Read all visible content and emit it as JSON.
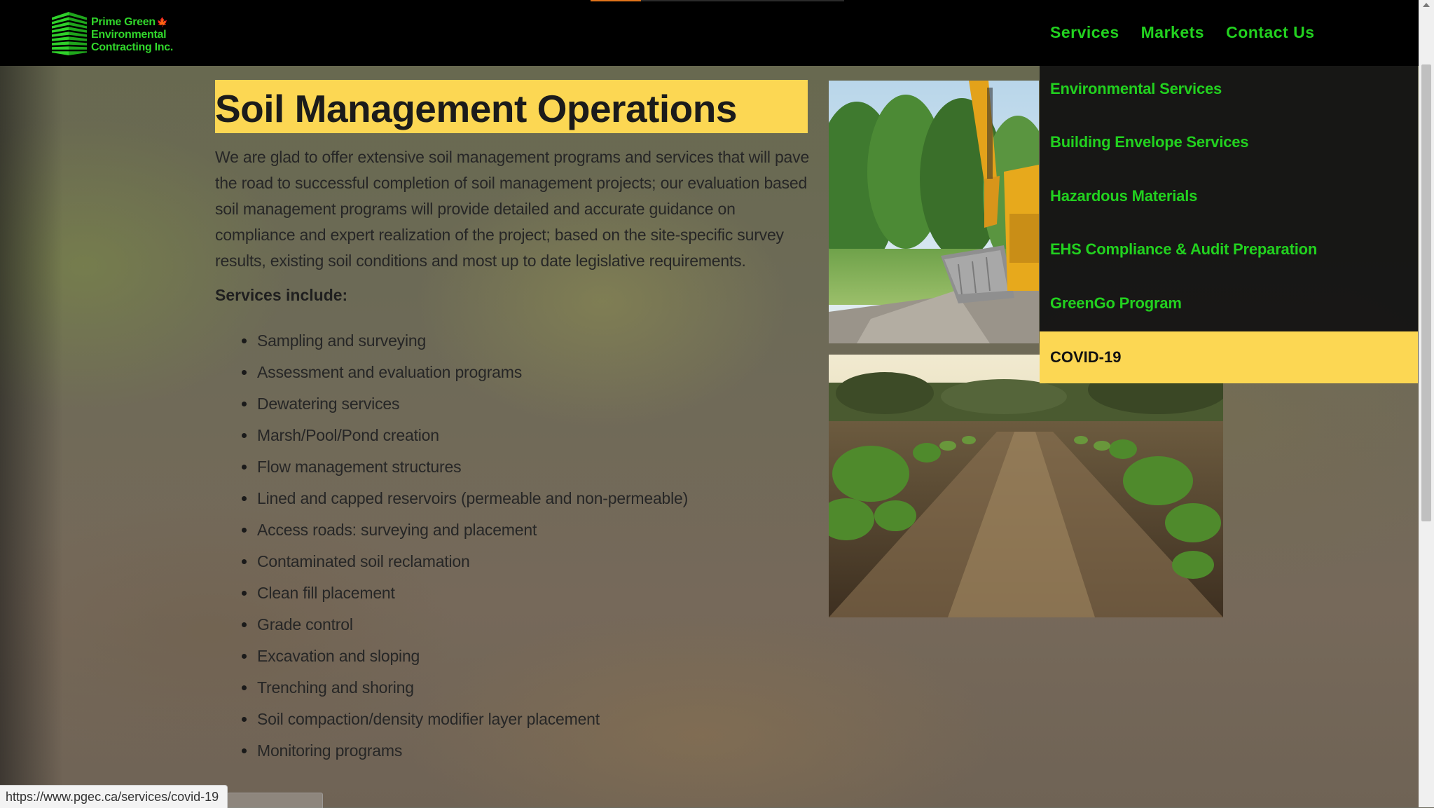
{
  "header": {
    "logo": {
      "line1": "Prime Green",
      "line2": "Environmental",
      "line3": "Contracting Inc.",
      "maple_icon": "maple-leaf-icon",
      "brand_green": "#31d62b",
      "maple_red": "#d3231e"
    },
    "nav": [
      {
        "label": "Services"
      },
      {
        "label": "Markets"
      },
      {
        "label": "Contact Us"
      }
    ],
    "background": "#000000",
    "nav_color": "#22d11f"
  },
  "dropdown": {
    "items": [
      {
        "label": "Environmental Services"
      },
      {
        "label": "Building Envelope Services"
      },
      {
        "label": "Hazardous Materials"
      },
      {
        "label": "EHS  Compliance & Audit Preparation"
      },
      {
        "label": "GreenGo Program"
      }
    ],
    "active": {
      "label": "COVID-19"
    },
    "active_bg": "#fcd753"
  },
  "main": {
    "title": "Soil Management Operations",
    "intro": "We are glad to offer extensive soil management programs and services that will pave the road to successful completion of soil management projects; our evaluation based soil management programs will provide detailed and accurate guidance on compliance and expert realization of the project; based on the site-specific survey results, existing soil conditions and most up to date legislative requirements.",
    "services_heading": "Services include:",
    "services": [
      "Sampling and surveying",
      "Assessment and evaluation programs",
      "Dewatering services",
      "Marsh/Pool/Pond creation",
      "Flow management structures",
      "Lined and capped reservoirs (permeable and non-permeable)",
      "Access roads: surveying and placement",
      "Contaminated soil reclamation",
      "Clean fill placement",
      "Grade control",
      "Excavation and sloping",
      "Trenching and shoring",
      "Soil compaction/density modifier layer placement",
      "Monitoring programs"
    ],
    "highlight_color": "#fcd753"
  },
  "status_bar": {
    "url": "https://www.pgec.ca/services/covid-19"
  }
}
